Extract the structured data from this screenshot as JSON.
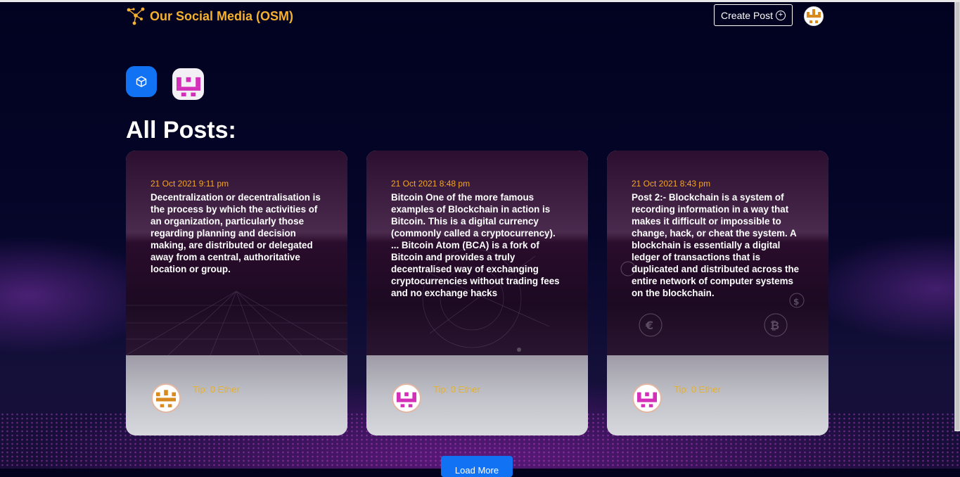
{
  "header": {
    "brand_title": "Our Social Media (OSM)",
    "brand_icon": "network-logo-icon",
    "create_post_label": "Create Post",
    "create_post_icon": "plus-circle-icon"
  },
  "profile_bar": {
    "cube_icon": "cube-icon",
    "profile_identicon": "identicon"
  },
  "section_title": "All Posts:",
  "posts": [
    {
      "date": "21 Oct 2021 9:11 pm",
      "text": "Decentralization or decentralisation is the process by which the activities of an organization, particularly those regarding planning and decision making, are distributed or delegated away from a central, authoritative location or group.",
      "tip": "Tip: 0 Ether",
      "identicon_color": "#d98a1e"
    },
    {
      "date": "21 Oct 2021 8:48 pm",
      "text": "Bitcoin One of the more famous examples of Blockchain in action is Bitcoin. This is a digital currency (commonly called a cryptocurrency). ... Bitcoin Atom (BCA) is a fork of Bitcoin and provides a truly decentralised way of exchanging cryptocurrencies without trading fees and no exchange hacks",
      "tip": "Tip: 0 Ether",
      "identicon_color": "#d42fb8"
    },
    {
      "date": "21 Oct 2021 8:43 pm",
      "text": "Post 2:- Blockchain is a system of recording information in a way that makes it difficult or impossible to change, hack, or cheat the system. A blockchain is essentially a digital ledger of transactions that is duplicated and distributed across the entire network of computer systems on the blockchain.",
      "tip": "Tip: 0 Ether",
      "identicon_color": "#d42fb8"
    }
  ],
  "load_more_label": "Load More",
  "colors": {
    "accent_orange": "#f5b02e",
    "primary_blue": "#1173f3",
    "background": "#03031e"
  }
}
